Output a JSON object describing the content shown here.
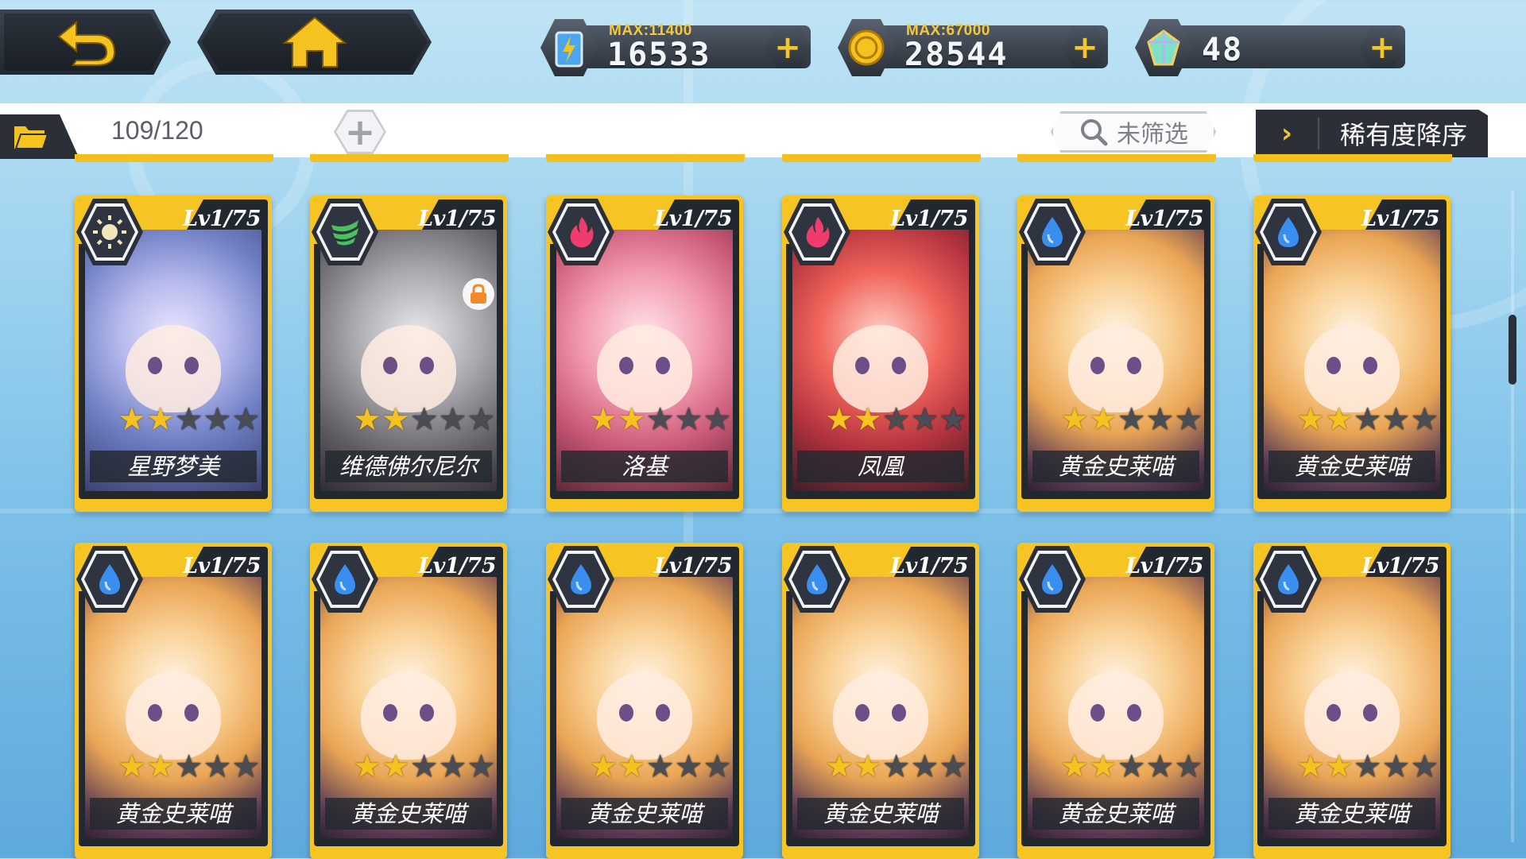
{
  "topbar": {
    "energy": {
      "max_label": "MAX:11400",
      "value": "16533",
      "plus": "+"
    },
    "gold": {
      "max_label": "MAX:67000",
      "value": "28544",
      "plus": "+"
    },
    "gems": {
      "value": "48",
      "plus": "+"
    }
  },
  "subbar": {
    "count": "109/120",
    "add_symbol": "+",
    "filter_label": "未筛选",
    "sort_chevron": "›",
    "sort_label": "稀有度降序"
  },
  "colors": {
    "card_gold": "#f6c524",
    "dark_panel": "#2b3038",
    "star_on": "#f5c21f",
    "star_off": "#4a4d54",
    "accent_plus": "#f2c531"
  },
  "cards": [
    {
      "level": "Lv1/75",
      "name": "星野梦美",
      "element": "light",
      "stars": 2,
      "max_stars": 5,
      "locked": false,
      "art": "blue"
    },
    {
      "level": "Lv1/75",
      "name": "维德佛尔尼尔",
      "element": "wind",
      "stars": 2,
      "max_stars": 5,
      "locked": true,
      "art": "gray"
    },
    {
      "level": "Lv1/75",
      "name": "洛基",
      "element": "fire",
      "stars": 2,
      "max_stars": 5,
      "locked": false,
      "art": "pink"
    },
    {
      "level": "Lv1/75",
      "name": "凤凰",
      "element": "fire",
      "stars": 2,
      "max_stars": 5,
      "locked": false,
      "art": "red"
    },
    {
      "level": "Lv1/75",
      "name": "黄金史莱喵",
      "element": "water",
      "stars": 2,
      "max_stars": 5,
      "locked": false,
      "art": "gold"
    },
    {
      "level": "Lv1/75",
      "name": "黄金史莱喵",
      "element": "water",
      "stars": 2,
      "max_stars": 5,
      "locked": false,
      "art": "gold"
    },
    {
      "level": "Lv1/75",
      "name": "黄金史莱喵",
      "element": "water",
      "stars": 2,
      "max_stars": 5,
      "locked": false,
      "art": "gold"
    },
    {
      "level": "Lv1/75",
      "name": "黄金史莱喵",
      "element": "water",
      "stars": 2,
      "max_stars": 5,
      "locked": false,
      "art": "gold"
    },
    {
      "level": "Lv1/75",
      "name": "黄金史莱喵",
      "element": "water",
      "stars": 2,
      "max_stars": 5,
      "locked": false,
      "art": "gold"
    },
    {
      "level": "Lv1/75",
      "name": "黄金史莱喵",
      "element": "water",
      "stars": 2,
      "max_stars": 5,
      "locked": false,
      "art": "gold"
    },
    {
      "level": "Lv1/75",
      "name": "黄金史莱喵",
      "element": "water",
      "stars": 2,
      "max_stars": 5,
      "locked": false,
      "art": "gold"
    },
    {
      "level": "Lv1/75",
      "name": "黄金史莱喵",
      "element": "water",
      "stars": 2,
      "max_stars": 5,
      "locked": false,
      "art": "gold"
    }
  ]
}
